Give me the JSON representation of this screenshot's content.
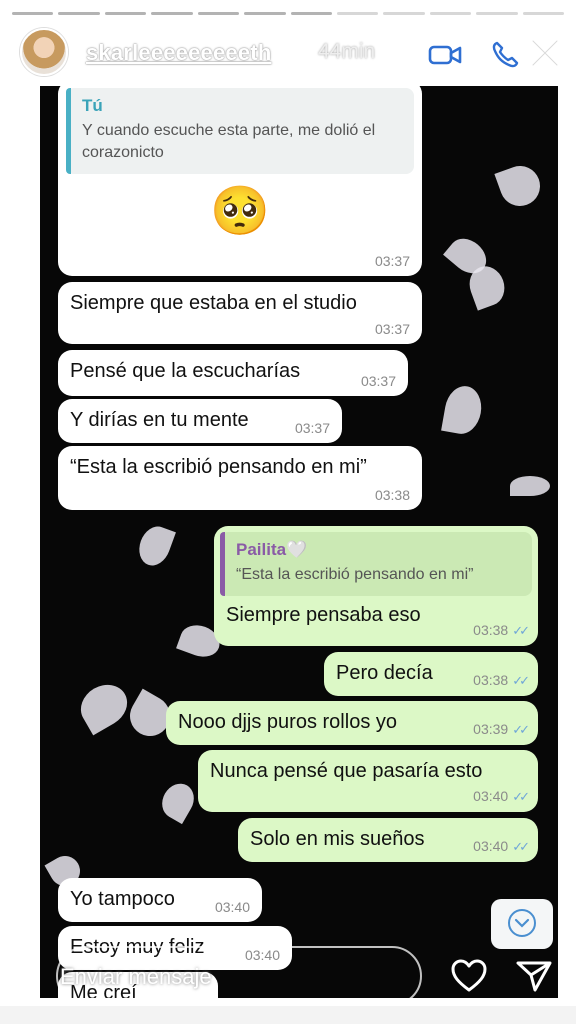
{
  "story": {
    "username": "skarleeeeeeeeeth",
    "time_ago": "44min",
    "segments_total": 12,
    "segments_done": 7,
    "reply_placeholder": "Enviar mensaje"
  },
  "chat": {
    "quoted_in": {
      "author": "Tú",
      "text": "Y cuando escuche esta parte, me dolió el corazonicto"
    },
    "emoji": "🥺",
    "emoji_time": "03:37",
    "messages": [
      {
        "text": "Siempre que estaba en el studio",
        "time": "03:37"
      },
      {
        "text": "Pensé que la escucharías",
        "time": "03:37"
      },
      {
        "text": "Y dirías en tu mente",
        "time": "03:37"
      },
      {
        "text": "“Esta la escribió pensando en mi”",
        "time": "03:38"
      }
    ],
    "quoted_out": {
      "author": "Pailita🤍",
      "text": "“Esta la escribió pensando en mi”"
    },
    "out_messages": [
      {
        "text": "Siempre pensaba eso",
        "time": "03:38"
      },
      {
        "text": "Pero decía",
        "time": "03:38"
      },
      {
        "text": "Nooo djjs puros rollos yo",
        "time": "03:39"
      },
      {
        "text": "Nunca pensé que pasaría esto",
        "time": "03:40"
      },
      {
        "text": "Solo en mis sueños",
        "time": "03:40"
      }
    ],
    "later_in": [
      {
        "text": "Yo tampoco",
        "time": "03:40"
      },
      {
        "text": "Estoy muy feliz",
        "time": "03:40"
      },
      {
        "text": "Me creí",
        "time": ""
      }
    ]
  },
  "colors": {
    "incoming": "#ffffff",
    "outgoing": "#dcf8c6",
    "read_ticks": "#6fa6d8"
  },
  "icons": [
    "video-icon",
    "phone-icon",
    "close-icon",
    "heart-icon",
    "send-icon",
    "scroll-down-icon"
  ]
}
